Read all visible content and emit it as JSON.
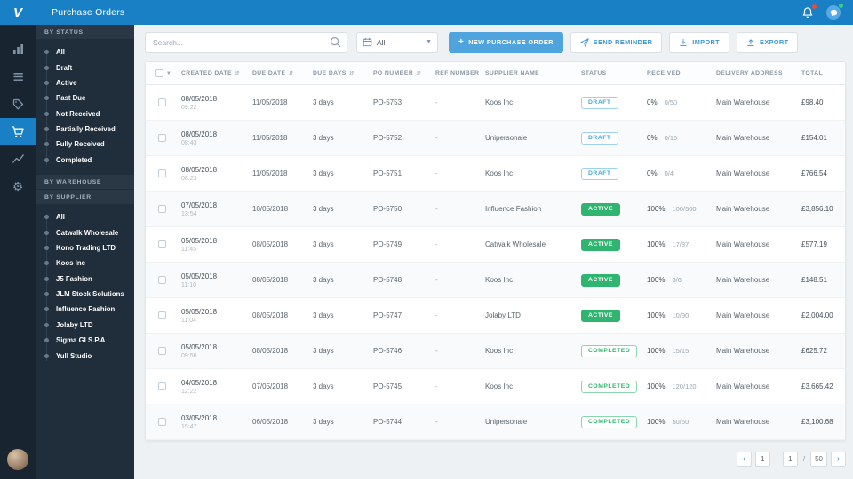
{
  "topbar": {
    "logo_letter": "V",
    "title": "Purchase Orders",
    "icons": [
      {
        "name": "notification-bell-icon",
        "badge_color": "#e84c3d"
      },
      {
        "name": "help-chat-icon",
        "badge_color": "#35d07f"
      }
    ]
  },
  "nav_rail": {
    "items": [
      {
        "icon": "bar-chart-icon",
        "active": false
      },
      {
        "icon": "list-icon",
        "active": false
      },
      {
        "icon": "tag-icon",
        "active": false
      },
      {
        "icon": "cart-icon",
        "active": true
      },
      {
        "icon": "trend-icon",
        "active": false
      },
      {
        "icon": "gear-icon",
        "active": false
      }
    ]
  },
  "filters": {
    "status_header": "BY STATUS",
    "status_items": [
      "All",
      "Draft",
      "Active",
      "Past Due",
      "Not Received",
      "Partially Received",
      "Fully Received",
      "Completed"
    ],
    "warehouse_header": "BY WAREHOUSE",
    "supplier_header": "BY SUPPLIER",
    "supplier_items": [
      "All",
      "Catwalk Wholesale",
      "Kono Trading LTD",
      "Koos Inc",
      "J5 Fashion",
      "JLM Stock Solutions",
      "Influence Fashion",
      "Jolaby LTD",
      "Sigma GI S.P.A",
      "Yull Studio"
    ]
  },
  "toolbar": {
    "search_placeholder": "Search...",
    "date_filter_value": "All",
    "new_purchase_order": "NEW PURCHASE ORDER",
    "send_reminder": "SEND REMINDER",
    "import": "IMPORT",
    "export": "EXPORT"
  },
  "table": {
    "columns": [
      {
        "label": "CREATED DATE",
        "sortable": true
      },
      {
        "label": "DUE DATE",
        "sortable": true
      },
      {
        "label": "DUE DAYS",
        "sortable": true
      },
      {
        "label": "PO NUMBER",
        "sortable": true
      },
      {
        "label": "REF NUMBER",
        "sortable": false
      },
      {
        "label": "SUPPLIER NAME",
        "sortable": false
      },
      {
        "label": "STATUS",
        "sortable": false
      },
      {
        "label": "RECEIVED",
        "sortable": false
      },
      {
        "label": "DELIVERY ADDRESS",
        "sortable": false
      },
      {
        "label": "TOTAL",
        "sortable": false
      }
    ],
    "rows": [
      {
        "created_date": "08/05/2018",
        "created_time": "09:22",
        "due_date": "11/05/2018",
        "due_days": "3 days",
        "po_number": "PO-5753",
        "ref_number": "-",
        "supplier": "Koos Inc",
        "status": "DRAFT",
        "received_pct": "0%",
        "received_qty": "0/50",
        "delivery_address": "Main Warehouse",
        "total": "£98.40"
      },
      {
        "created_date": "08/05/2018",
        "created_time": "08:43",
        "due_date": "11/05/2018",
        "due_days": "3 days",
        "po_number": "PO-5752",
        "ref_number": "-",
        "supplier": "Unipersonale",
        "status": "DRAFT",
        "received_pct": "0%",
        "received_qty": "0/15",
        "delivery_address": "Main Warehouse",
        "total": "£154.01"
      },
      {
        "created_date": "08/05/2018",
        "created_time": "08:23",
        "due_date": "11/05/2018",
        "due_days": "3 days",
        "po_number": "PO-5751",
        "ref_number": "-",
        "supplier": "Koos Inc",
        "status": "DRAFT",
        "received_pct": "0%",
        "received_qty": "0/4",
        "delivery_address": "Main Warehouse",
        "total": "£766.54"
      },
      {
        "created_date": "07/05/2018",
        "created_time": "13:54",
        "due_date": "10/05/2018",
        "due_days": "3 days",
        "po_number": "PO-5750",
        "ref_number": "-",
        "supplier": "Influence Fashion",
        "status": "ACTIVE",
        "received_pct": "100%",
        "received_qty": "100/500",
        "delivery_address": "Main Warehouse",
        "total": "£3,856.10"
      },
      {
        "created_date": "05/05/2018",
        "created_time": "11:45",
        "due_date": "08/05/2018",
        "due_days": "3 days",
        "po_number": "PO-5749",
        "ref_number": "-",
        "supplier": "Catwalk Wholesale",
        "status": "ACTIVE",
        "received_pct": "100%",
        "received_qty": "17/87",
        "delivery_address": "Main Warehouse",
        "total": "£577.19"
      },
      {
        "created_date": "05/05/2018",
        "created_time": "11:10",
        "due_date": "08/05/2018",
        "due_days": "3 days",
        "po_number": "PO-5748",
        "ref_number": "-",
        "supplier": "Koos Inc",
        "status": "ACTIVE",
        "received_pct": "100%",
        "received_qty": "3/6",
        "delivery_address": "Main Warehouse",
        "total": "£148.51"
      },
      {
        "created_date": "05/05/2018",
        "created_time": "11:04",
        "due_date": "08/05/2018",
        "due_days": "3 days",
        "po_number": "PO-5747",
        "ref_number": "-",
        "supplier": "Jolaby LTD",
        "status": "ACTIVE",
        "received_pct": "100%",
        "received_qty": "10/90",
        "delivery_address": "Main Warehouse",
        "total": "£2,004.00"
      },
      {
        "created_date": "05/05/2018",
        "created_time": "09:56",
        "due_date": "08/05/2018",
        "due_days": "3 days",
        "po_number": "PO-5746",
        "ref_number": "-",
        "supplier": "Koos Inc",
        "status": "COMPLETED",
        "received_pct": "100%",
        "received_qty": "15/15",
        "delivery_address": "Main Warehouse",
        "total": "£625.72"
      },
      {
        "created_date": "04/05/2018",
        "created_time": "12:22",
        "due_date": "07/05/2018",
        "due_days": "3 days",
        "po_number": "PO-5745",
        "ref_number": "-",
        "supplier": "Koos Inc",
        "status": "COMPLETED",
        "received_pct": "100%",
        "received_qty": "120/120",
        "delivery_address": "Main Warehouse",
        "total": "£3,665.42"
      },
      {
        "created_date": "03/05/2018",
        "created_time": "15:47",
        "due_date": "06/05/2018",
        "due_days": "3 days",
        "po_number": "PO-5744",
        "ref_number": "-",
        "supplier": "Unipersonale",
        "status": "COMPLETED",
        "received_pct": "100%",
        "received_qty": "50/50",
        "delivery_address": "Main Warehouse",
        "total": "£3,100.68"
      }
    ]
  },
  "pagination": {
    "prev": "‹",
    "first_page": "1",
    "current_page": "1",
    "separator": "/",
    "total_pages": "50",
    "next": "›"
  },
  "colors": {
    "brand_blue": "#1a80c6",
    "button_blue": "#4fa4de",
    "status_green": "#2fb56f",
    "status_draft_blue": "#45a7db"
  }
}
